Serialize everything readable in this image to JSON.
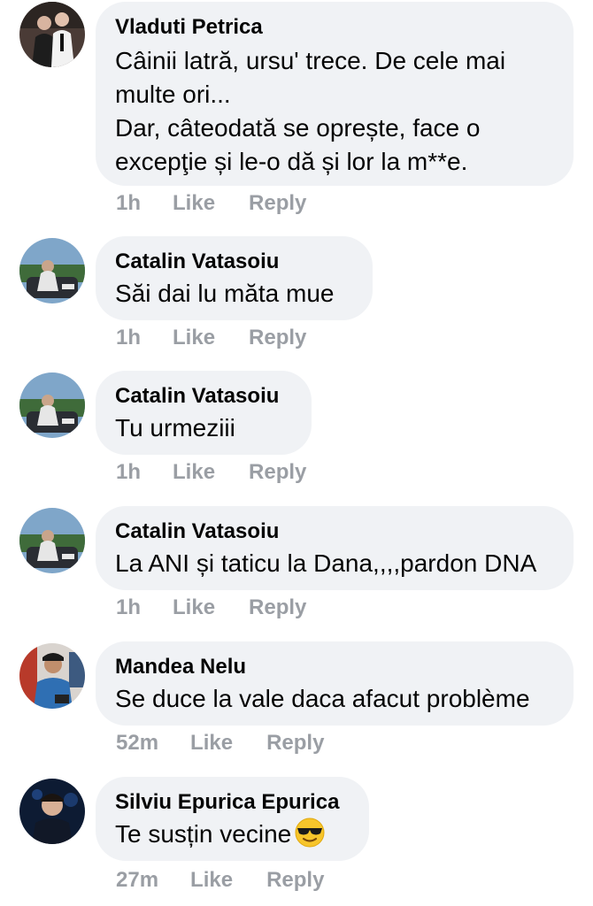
{
  "comments": [
    {
      "author": "Vladuti Petrica",
      "text": "Câinii latră, ursu' trece. De cele mai\nmulte ori...\nDar, câteodată se oprește, face o\nexcepţie și le-o dă și lor la m**e.",
      "time": "1h",
      "like": "Like",
      "reply": "Reply"
    },
    {
      "author": "Catalin Vatasoiu",
      "text": "Săi dai lu măta mue",
      "time": "1h",
      "like": "Like",
      "reply": "Reply"
    },
    {
      "author": "Catalin Vatasoiu",
      "text": "Tu urmeziii",
      "time": "1h",
      "like": "Like",
      "reply": "Reply"
    },
    {
      "author": "Catalin Vatasoiu",
      "text": "La ANI și taticu la Dana,,,,pardon DNA",
      "time": "1h",
      "like": "Like",
      "reply": "Reply"
    },
    {
      "author": "Mandea Nelu",
      "text": "Se duce la vale daca afacut problème",
      "time": "52m",
      "like": "Like",
      "reply": "Reply"
    },
    {
      "author": "Silviu Epurica Epurica",
      "text": "Te susțin vecine",
      "emoji": "sunglasses-emoji",
      "time": "27m",
      "like": "Like",
      "reply": "Reply"
    }
  ],
  "colors": {
    "bubble": "#f0f2f5",
    "meta": "#9a9ea4",
    "text": "#050505"
  }
}
